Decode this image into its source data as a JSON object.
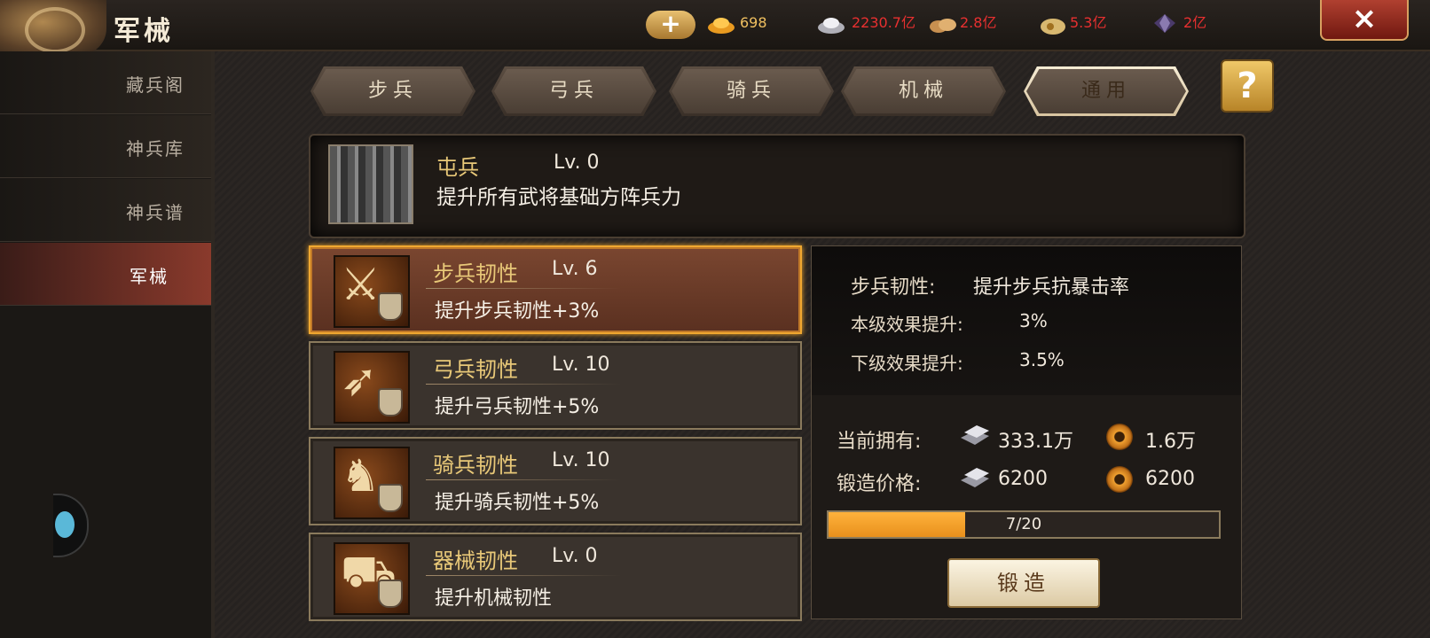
{
  "header": {
    "title": "军械",
    "add_button": "+",
    "gold_ingot": "698",
    "silver": "2230.7亿",
    "grain": "2.8亿",
    "coins": "5.3亿",
    "gem": "2亿",
    "close_icon": "×"
  },
  "sidebar": {
    "items": [
      {
        "label": "藏兵阁"
      },
      {
        "label": "神兵库"
      },
      {
        "label": "神兵谱"
      },
      {
        "label": "军械"
      }
    ]
  },
  "tabs": [
    {
      "label": "步兵"
    },
    {
      "label": "弓兵"
    },
    {
      "label": "骑兵"
    },
    {
      "label": "机械"
    },
    {
      "label": "通用"
    }
  ],
  "help_icon": "?",
  "banner": {
    "name": "屯兵",
    "level": "Lv. 0",
    "desc": "提升所有武将基础方阵兵力"
  },
  "skills": [
    {
      "name": "步兵韧性",
      "level": "Lv. 6",
      "desc": "提升步兵韧性+3%",
      "icon": "sword-icon"
    },
    {
      "name": "弓兵韧性",
      "level": "Lv. 10",
      "desc": "提升弓兵韧性+5%",
      "icon": "bow-icon"
    },
    {
      "name": "骑兵韧性",
      "level": "Lv. 10",
      "desc": "提升骑兵韧性+5%",
      "icon": "horse-icon"
    },
    {
      "name": "器械韧性",
      "level": "Lv. 0",
      "desc": "提升机械韧性",
      "icon": "catapult-icon"
    }
  ],
  "detail": {
    "title_label": "步兵韧性:",
    "title_value": "提升步兵抗暴击率",
    "current_label": "本级效果提升:",
    "current_value": "3%",
    "next_label": "下级效果提升:",
    "next_value": "3.5%",
    "owned_label": "当前拥有:",
    "owned_silver": "333.1万",
    "owned_gear": "1.6万",
    "cost_label": "锻造价格:",
    "cost_silver": "6200",
    "cost_gear": "6200",
    "progress_text": "7/20",
    "progress_value": 7,
    "progress_max": 20,
    "forge_button": "锻造"
  },
  "colors": {
    "accent_gold": "#e8c878",
    "active_border": "#f0a830",
    "progress_fill": "#f0a030",
    "close_red": "#b04030"
  }
}
